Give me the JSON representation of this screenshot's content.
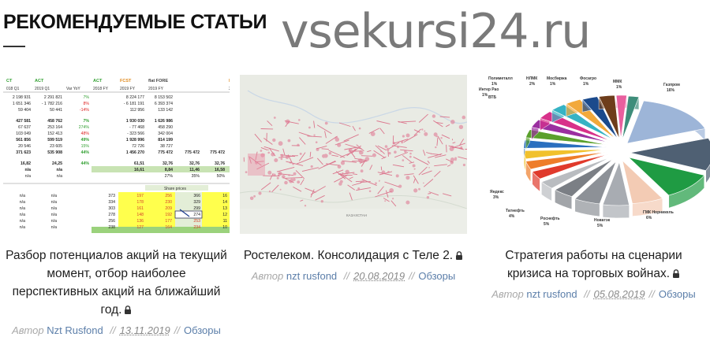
{
  "section": {
    "title": "РЕКОМЕНДУЕМЫЕ СТАТЬИ"
  },
  "watermark": {
    "text": "vsekursi24.ru"
  },
  "cards": [
    {
      "title": "Разбор потенциалов акций на текущий момент, отбор наиболее перспективных акций на ближайший год.",
      "author_label": "Автор",
      "author": "Nzt Rusfond",
      "date": "13.11.2019",
      "category": "Обзоры",
      "separator": "//",
      "lock_icon": "lock-icon"
    },
    {
      "title": "Ростелеком. Консолидация с Теле 2.",
      "author_label": "Автор",
      "author": "nzt rusfond",
      "date": "20.08.2019",
      "category": "Обзоры",
      "separator": "//",
      "lock_icon": "lock-icon"
    },
    {
      "title": "Стратегия работы на сценарии кризиса на торговых войнах.",
      "author_label": "Автор",
      "author": "nzt rusfond",
      "date": "05.08.2019",
      "category": "Обзоры",
      "separator": "//",
      "lock_icon": "lock-icon"
    }
  ],
  "thumb_table": {
    "col_heads": [
      "CT",
      "ACT",
      "",
      "ACT",
      "FCST",
      "flat FORE",
      "",
      "",
      "FCST"
    ],
    "sub_heads": [
      "018 Q1",
      "2019 Q1",
      "Var YoY",
      "2018 FY",
      "2019 FY",
      "2019 FY",
      "",
      "",
      "2019 FY"
    ],
    "rows": [
      [
        "2 198 931",
        "2 291 821",
        "7%",
        "8 224 177",
        "8 153 502",
        "",
        "",
        "7 813 5"
      ],
      [
        "1 651 346",
        "- 1 782 216",
        "8%",
        "- 6 181 191",
        "6 393 374",
        "",
        "",
        "6 126 3"
      ],
      [
        "59 404",
        "50 441",
        "-14%",
        "112 956",
        "133 142",
        "",
        "",
        "133 14"
      ],
      [
        "427 581",
        "458 762",
        "7%",
        "1 930 030",
        "1 626 986",
        "",
        "",
        "1 553 8"
      ],
      [
        "67 637",
        "253 164",
        "274%",
        "- 77 468",
        "458 290",
        "",
        "",
        "458 29"
      ],
      [
        "103 049",
        "152 413",
        "48%",
        "- 323 566",
        "342 004",
        "",
        "",
        "342 00"
      ],
      [
        "561 856",
        "599 519",
        "49%",
        "1 928 996",
        "814 199",
        "",
        "",
        "676 0"
      ],
      [
        "20 546",
        "23 605",
        "15%",
        "72 726",
        "38 727",
        "",
        "",
        "38 72"
      ],
      [
        "371 623",
        "535 908",
        "44%",
        "1 456 270",
        "775 472",
        "775 472",
        "775 472",
        "775 47"
      ],
      [
        "16,82",
        "24,25",
        "44%",
        "61,51",
        "32,76",
        "32,76",
        "32,76",
        "32,7"
      ],
      [
        "n/a",
        "n/a",
        "",
        "16,61",
        "8,84",
        "11,46",
        "16,58",
        "8,1"
      ],
      [
        "n/a",
        "n/a",
        "",
        "",
        "27%",
        "35%",
        "50%",
        ""
      ]
    ],
    "share_label": "Share prices",
    "price_rows": [
      [
        "n/a",
        "n/a",
        "373",
        "197",
        "256",
        "366",
        "16"
      ],
      [
        "n/a",
        "n/a",
        "334",
        "178",
        "230",
        "329",
        "14"
      ],
      [
        "n/a",
        "n/a",
        "303",
        "161",
        "209",
        "299",
        "13"
      ],
      [
        "n/a",
        "n/a",
        "278",
        "148",
        "192",
        "274",
        "12"
      ],
      [
        "n/a",
        "n/a",
        "256",
        "136",
        "177",
        "253",
        "11"
      ],
      [
        "n/a",
        "n/a",
        "238",
        "127",
        "164",
        "234",
        "10"
      ]
    ]
  },
  "thumb_map": {
    "label": "КАЗАХСТАН"
  },
  "thumb_pie": {
    "labels": [
      {
        "text": "Полиметалл",
        "pct": "1%"
      },
      {
        "text": "НЛМК",
        "pct": "2%"
      },
      {
        "text": "Мосбиржа",
        "pct": "1%"
      },
      {
        "text": "Фосагро",
        "pct": "1%"
      },
      {
        "text": "ММК",
        "pct": "1%"
      },
      {
        "text": "Интер Рао",
        "pct": "1%"
      },
      {
        "text": "ВТБ",
        "pct": ""
      },
      {
        "text": "Газпром",
        "pct": "16%"
      },
      {
        "text": "Яндекс",
        "pct": "3%"
      },
      {
        "text": "Татнефть",
        "pct": "4%"
      },
      {
        "text": "Роснефть",
        "pct": "5%"
      },
      {
        "text": "Новатэк",
        "pct": "5%"
      },
      {
        "text": "ГМК Норникель",
        "pct": "6%"
      }
    ]
  }
}
